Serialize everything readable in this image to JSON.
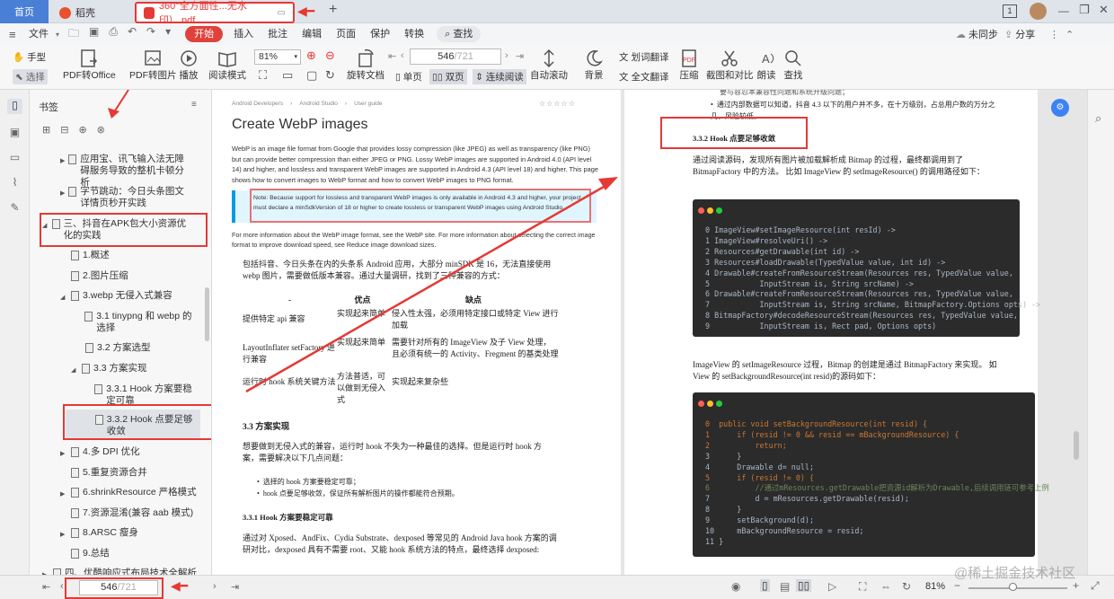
{
  "titlebar": {
    "tabs": [
      {
        "label": "首页"
      },
      {
        "label": "稻壳"
      },
      {
        "label": "360°全方面性...无水印）.pdf"
      }
    ],
    "add_tab": "+",
    "page_badge": "1"
  },
  "menubar": {
    "file": "文件",
    "items": [
      "开始",
      "插入",
      "批注",
      "编辑",
      "页面",
      "保护",
      "转换"
    ],
    "search": "查找",
    "sync": "未同步",
    "share": "分享"
  },
  "ribbon": {
    "hand": "手型",
    "select": "选择",
    "pdf_to_office": "PDF转Office",
    "pdf_to_image": "PDF转图片",
    "play": "播放",
    "reading_mode": "阅读模式",
    "zoom": "81%",
    "rotate": "旋转文档",
    "page_current": "546",
    "page_total": "/721",
    "single": "单页",
    "double": "双页",
    "continuous": "连续阅读",
    "auto_scroll": "自动滚动",
    "background": "背景",
    "translate_word": "划词翻译",
    "translate_full": "全文翻译",
    "compress": "压缩",
    "screenshot": "截图和对比",
    "read_aloud": "朗读",
    "find": "查找"
  },
  "bookmarks": {
    "title": "书签",
    "items": [
      {
        "label": "应用宝、讯飞输入法无障碍服务导致的整机卡顿分析"
      },
      {
        "label": "字节跳动：今日头条图文详情页秒开实践"
      },
      {
        "label": "三、抖音在APK包大小资源优化的实践"
      },
      {
        "label": "1.概述"
      },
      {
        "label": "2.图片压缩"
      },
      {
        "label": "3.webp 无侵入式兼容"
      },
      {
        "label": "3.1 tinypng 和 webp 的选择"
      },
      {
        "label": "3.2 方案选型"
      },
      {
        "label": "3.3 方案实现"
      },
      {
        "label": "3.3.1 Hook 方案要稳定可靠"
      },
      {
        "label": "3.3.2 Hook 点要足够收敛"
      },
      {
        "label": "4.多 DPI 优化"
      },
      {
        "label": "5.重复资源合并"
      },
      {
        "label": "6.shrinkResource 严格模式"
      },
      {
        "label": "7.资源混淆(兼容 aab 模式)"
      },
      {
        "label": "8.ARSC 瘦身"
      },
      {
        "label": "9.总结"
      },
      {
        "label": "四、优酷响应式布局技术全解析"
      }
    ]
  },
  "left_page": {
    "breadcrumb": [
      "Android Developers",
      "Android Studio",
      "User guide"
    ],
    "title": "Create WebP images",
    "intro": "WebP is an image file format from Google that provides lossy compression (like JPEG) as well as transparency (like PNG) but can provide better compression than either JPEG or PNG. Lossy WebP images are supported in Android 4.0 (API level 14) and higher, and lossless and transparent WebP images are supported in Android 4.3 (API level 18) and higher. This page shows how to convert images to WebP format and how to convert WebP images to PNG format.",
    "note": "Note: Because support for lossless and transparent WebP images is only available in Android 4.3 and higher, your project must declare a minSdkVersion of 18 or higher to create lossless or transparent WebP images using Android Studio.",
    "more_info": "For more information about the WebP image format, see the WebP site. For more information about selecting the correct image format to improve download speed, see Reduce image download sizes.",
    "para1": "包括抖音、今日头条在内的头条系 Android 应用，大部分 minSDK 是 16，无法直接使用 webp 图片，需要做低版本兼容。通过大量调研，找到了三种兼容的方式：",
    "table": {
      "headers": [
        "-",
        "优点",
        "缺点"
      ],
      "rows": [
        [
          "提供特定 api 兼容",
          "实现起来简单",
          "侵入性太强，必须用特定接口或特定 View 进行加载"
        ],
        [
          "LayoutInflater setFactory 进行兼容",
          "实现起来简单",
          "需要针对所有的 ImageView 及子 View 处理，且必须有统一的 Activity、Fregment 的基类处理"
        ],
        [
          "运行时 hook 系统关键方法",
          "方法普适，可以做到无侵入式",
          "实现起来复杂些"
        ]
      ]
    },
    "h33": "3.3 方案实现",
    "para2": "想要做到无侵入式的兼容，运行时 hook 不失为一种最佳的选择。但是运行时 hook 方案，需要解决以下几点问题：",
    "bullets": [
      "选择的 hook 方案要稳定可靠；",
      "hook 点要足够收敛，保证所有解析图片的操作都能符合预期。"
    ],
    "h331": "3.3.1 Hook 方案要稳定可靠",
    "para3": "通过对 Xposed、AndFix、Cydia Substrate、dexposed 等常见的 Android Java hook 方案的调研对比，dexposed 具有不需要 root、又能 hook 系统方法的特点，最终选择 dexposed:"
  },
  "right_page": {
    "top_partial": "要与容忍本兼容性问题和系统升级问题；",
    "top_bullet": "通过内部数据可以知道，抖音 4.3 以下的用户并不多，在十万级别，占总用户数的万分之几，风险较低。",
    "h332": "3.3.2 Hook 点要足够收敛",
    "para1": "通过阅读源码，发现所有图片被加载解析成 Bitmap 的过程，最终都调用到了 BitmapFactory 中的方法。 比如 ImageView 的 setImageResource() 的调用路径如下：",
    "code1": [
      "0 ImageView#setImageResource(int resId) ->",
      "1 ImageView#resolveUri() ->",
      "2 Resources#getDrawable(int id) ->",
      "3 Resources#loadDrawable(TypedValue value, int id) ->",
      "4 Drawable#createFromResourceStream(Resources res, TypedValue value,",
      "5           InputStream is, String srcName) ->",
      "6 Drawable#createFromResourceStream(Resources res, TypedValue value,",
      "7           InputStream is, String srcName, BitmapFactory.Options opts) ->",
      "8 BitmapFactory#decodeResourceStream(Resources res, TypedValue value,",
      "9           InputStream is, Rect pad, Options opts)"
    ],
    "para2": "ImageView 的 setImageResource 过程，Bitmap 的创建是通过 BitmapFactory 来实现。 如 View 的 setBackgroundResource(int resid)的源码如下：",
    "code2": [
      "0  public void setBackgroundResource(int resid) {",
      "1      if (resid != 0 && resid == mBackgroundResource) {",
      "2          return;",
      "3      }",
      "4      Drawable d= null;",
      "5      if (resid != 0) {",
      "6          //通过mResources.getDrawable把资源id解析为Drawable,后续调用链可参考上例",
      "7          d = mResources.getDrawable(resid);",
      "8      }",
      "9      setBackground(d);",
      "10     mBackgroundResource = resid;",
      "11 }"
    ]
  },
  "statusbar": {
    "page_current": "546",
    "page_total": "/721",
    "zoom": "81%"
  },
  "watermark": "@稀土掘金技术社区"
}
